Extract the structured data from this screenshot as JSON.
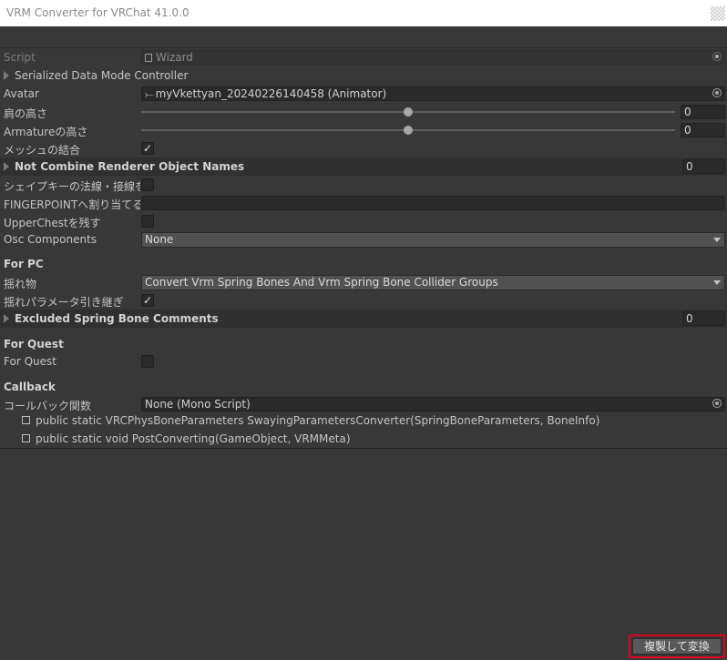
{
  "window": {
    "title": "VRM Converter for VRChat 41.0.0"
  },
  "script_row": {
    "label": "Script",
    "value": "Wizard",
    "icon": "script-file-icon"
  },
  "serialized_controller": {
    "label": "Serialized Data Mode Controller"
  },
  "avatar": {
    "label": "Avatar",
    "value": "myVkettyan_20240226140458 (Animator)",
    "icon": "avatar-object-icon"
  },
  "shoulder_height": {
    "label": "肩の高さ",
    "value": "0",
    "slider_fraction": 0.5
  },
  "armature_height": {
    "label": "Armatureの高さ",
    "value": "0",
    "slider_fraction": 0.5
  },
  "combine_meshes": {
    "label": "メッシュの結合",
    "checked": true,
    "glyph": "✓"
  },
  "not_combine_names": {
    "label": "Not Combine Renderer Object Names",
    "count": "0"
  },
  "shapekey_normals": {
    "label": "シェイプキーの法線・接線を利用",
    "checked": false
  },
  "fingerpoint": {
    "label": "FINGERPOINTへ割り当てる表",
    "value": ""
  },
  "keep_upperchest": {
    "label": "UpperChestを残す",
    "checked": false
  },
  "osc_components": {
    "label": "Osc Components",
    "value": "None"
  },
  "for_pc": {
    "header": "For PC",
    "swaying": {
      "label": "揺れ物",
      "value": "Convert Vrm Spring Bones And Vrm Spring Bone Collider Groups"
    },
    "take_over_params": {
      "label": "揺れパラメータ引き継ぎ",
      "checked": true,
      "glyph": "✓"
    },
    "excluded_comments": {
      "label": "Excluded Spring Bone Comments",
      "count": "0"
    }
  },
  "for_quest": {
    "header": "For Quest",
    "toggle": {
      "label": "For Quest",
      "checked": false
    }
  },
  "callback": {
    "header": "Callback",
    "function": {
      "label": "コールバック関数",
      "value": "None (Mono Script)"
    },
    "signatures": [
      "public static VRCPhysBoneParameters SwayingParametersConverter(SpringBoneParameters, BoneInfo)",
      "public static void PostConverting(GameObject, VRMMeta)"
    ]
  },
  "footer": {
    "convert_button": "複製して変換"
  },
  "colors": {
    "background": "#383838",
    "field": "#2a2a2a",
    "popup": "#515151",
    "highlight": "#e0001b"
  }
}
